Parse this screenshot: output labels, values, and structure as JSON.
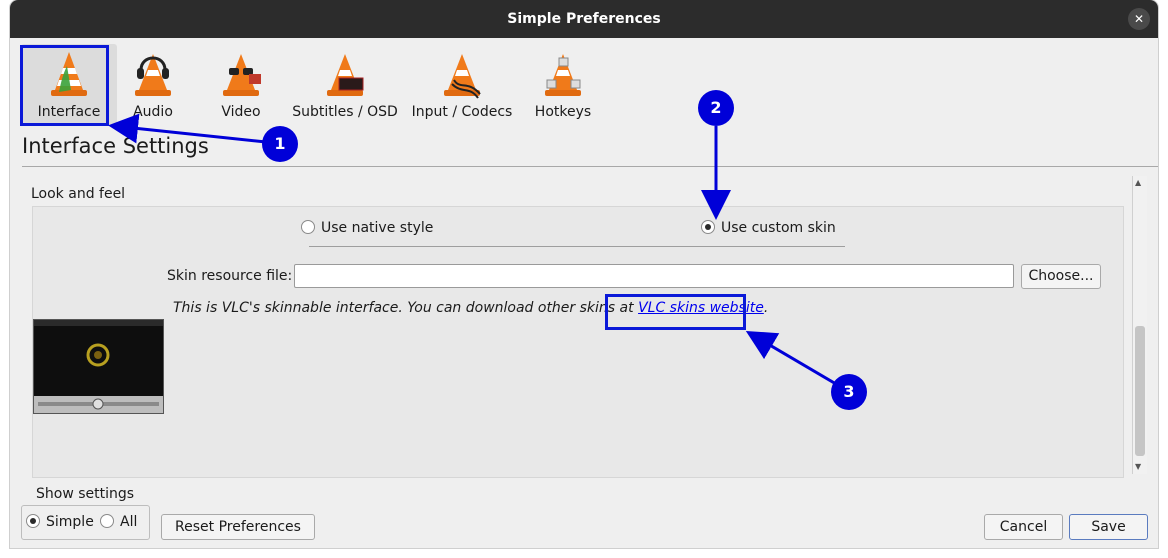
{
  "window": {
    "title": "Simple Preferences",
    "close_glyph": "✕"
  },
  "categories": [
    {
      "label": "Interface",
      "icon": "interface-cone-icon",
      "selected": true
    },
    {
      "label": "Audio",
      "icon": "audio-cone-headphones-icon",
      "selected": false
    },
    {
      "label": "Video",
      "icon": "video-cone-glasses-icon",
      "selected": false
    },
    {
      "label": "Subtitles / OSD",
      "icon": "subtitles-cone-icon",
      "selected": false
    },
    {
      "label": "Input / Codecs",
      "icon": "input-codecs-cone-icon",
      "selected": false
    },
    {
      "label": "Hotkeys",
      "icon": "hotkeys-cone-icon",
      "selected": false
    }
  ],
  "page": {
    "heading": "Interface Settings",
    "section": "Look and feel"
  },
  "style_options": {
    "native": "Use native style",
    "custom": "Use custom skin",
    "selected": "custom"
  },
  "skin": {
    "label": "Skin resource file:",
    "value": "",
    "choose_button": "Choose...",
    "info_text": "This is VLC's skinnable interface. You can download other skins at",
    "link_text": "VLC skins website",
    "info_suffix": "."
  },
  "show_settings": {
    "label": "Show settings",
    "simple": "Simple",
    "all": "All",
    "selected": "simple"
  },
  "buttons": {
    "reset": "Reset Preferences",
    "cancel": "Cancel",
    "save": "Save"
  },
  "annotations": {
    "marker1": "1",
    "marker2": "2",
    "marker3": "3"
  },
  "colors": {
    "annotation": "#0000d8",
    "titlebar": "#2c2c2c",
    "link": "#0000ee"
  }
}
